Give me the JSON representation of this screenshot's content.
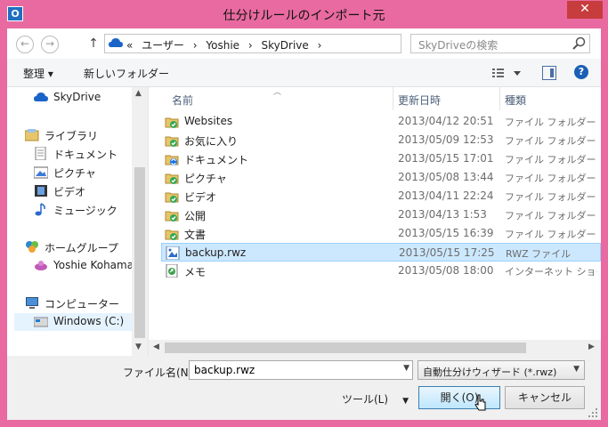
{
  "window": {
    "title": "仕分けルールのインポート元",
    "app_icon": "outlook-icon",
    "close_label": "✕"
  },
  "nav": {
    "back_icon": "back-arrow-icon",
    "forward_icon": "forward-arrow-icon",
    "up_icon": "up-arrow-icon"
  },
  "address": {
    "prefix": "«",
    "crumbs": [
      "ユーザー",
      "Yoshie",
      "SkyDrive"
    ],
    "separator": "›"
  },
  "search": {
    "placeholder": "SkyDriveの検索"
  },
  "toolbar": {
    "organize_label": "整理 ▾",
    "new_folder_label": "新しいフォルダー"
  },
  "navpane": {
    "items": [
      {
        "label": "SkyDrive",
        "icon": "cloud-icon"
      },
      {
        "label": "ライブラリ",
        "icon": "library-icon"
      },
      {
        "label": "ドキュメント",
        "icon": "document-icon"
      },
      {
        "label": "ピクチャ",
        "icon": "picture-icon"
      },
      {
        "label": "ビデオ",
        "icon": "video-icon"
      },
      {
        "label": "ミュージック",
        "icon": "music-icon"
      },
      {
        "label": "ホームグループ",
        "icon": "homegroup-icon"
      },
      {
        "label": "Yoshie Kohama",
        "icon": "user-icon"
      },
      {
        "label": "コンピューター",
        "icon": "computer-icon"
      },
      {
        "label": "Windows (C:)",
        "icon": "drive-icon"
      }
    ]
  },
  "filelist": {
    "columns": {
      "name": "名前",
      "modified": "更新日時",
      "type": "種類"
    },
    "rows": [
      {
        "name": "Websites",
        "date": "2013/04/12 20:51",
        "type": "ファイル フォルダー",
        "icon": "synced-folder-icon"
      },
      {
        "name": "お気に入り",
        "date": "2013/05/09 12:53",
        "type": "ファイル フォルダー",
        "icon": "synced-folder-icon"
      },
      {
        "name": "ドキュメント",
        "date": "2013/05/15 17:01",
        "type": "ファイル フォルダー",
        "icon": "syncing-folder-icon"
      },
      {
        "name": "ピクチャ",
        "date": "2013/05/08 13:44",
        "type": "ファイル フォルダー",
        "icon": "synced-folder-icon"
      },
      {
        "name": "ビデオ",
        "date": "2013/04/11 22:24",
        "type": "ファイル フォルダー",
        "icon": "synced-folder-icon"
      },
      {
        "name": "公開",
        "date": "2013/04/13 1:53",
        "type": "ファイル フォルダー",
        "icon": "synced-folder-icon"
      },
      {
        "name": "文書",
        "date": "2013/05/15 16:39",
        "type": "ファイル フォルダー",
        "icon": "synced-folder-icon"
      },
      {
        "name": "backup.rwz",
        "date": "2013/05/15 17:25",
        "type": "RWZ ファイル",
        "icon": "rwz-file-icon",
        "selected": true
      },
      {
        "name": "メモ",
        "date": "2013/05/08 18:00",
        "type": "インターネット ショー…",
        "icon": "shortcut-file-icon"
      }
    ]
  },
  "bottom": {
    "filename_label": "ファイル名(N):",
    "filename_value": "backup.rwz",
    "filter_value": "自動仕分けウィザード (*.rwz)",
    "tools_label": "ツール(L)",
    "open_label": "開く(O)",
    "cancel_label": "キャンセル"
  }
}
